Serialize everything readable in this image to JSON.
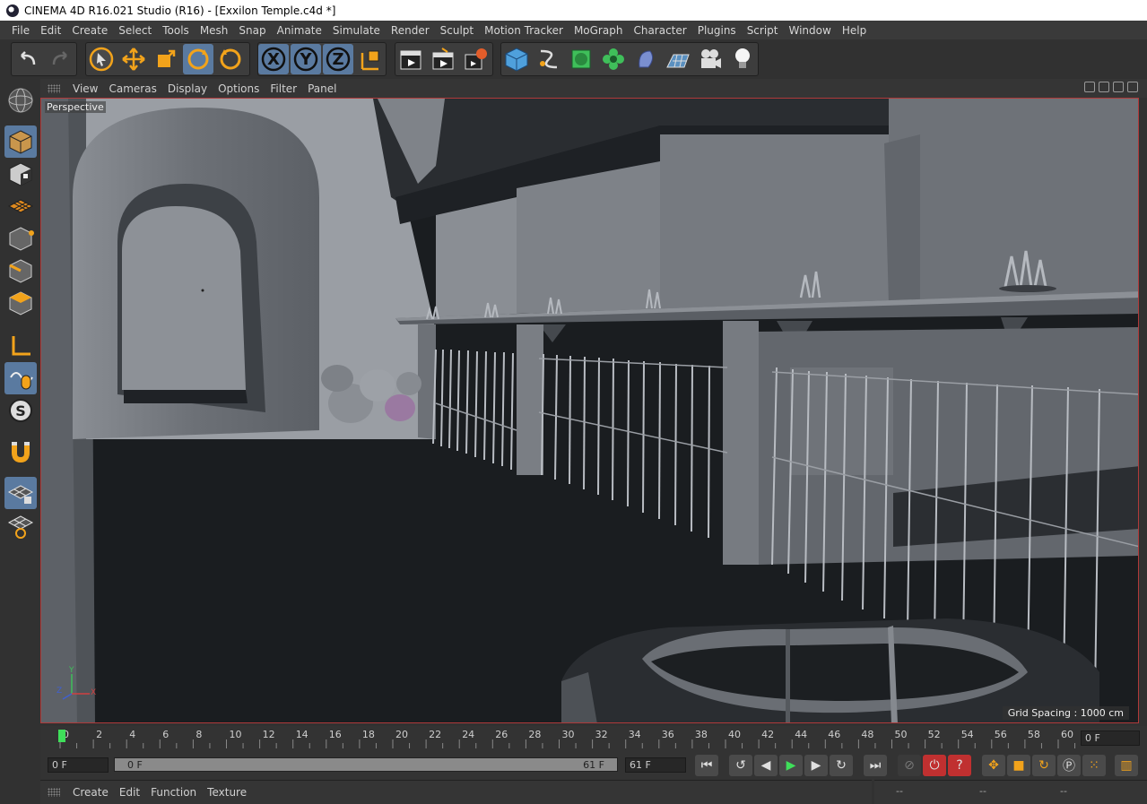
{
  "window": {
    "title": "CINEMA 4D R16.021 Studio (R16) - [Exxilon Temple.c4d *]"
  },
  "menu": [
    "File",
    "Edit",
    "Create",
    "Select",
    "Tools",
    "Mesh",
    "Snap",
    "Animate",
    "Simulate",
    "Render",
    "Sculpt",
    "Motion Tracker",
    "MoGraph",
    "Character",
    "Plugins",
    "Script",
    "Window",
    "Help"
  ],
  "toolbar": {
    "axis_x": "X",
    "axis_y": "Y",
    "axis_z": "Z"
  },
  "viewport": {
    "menu": [
      "View",
      "Cameras",
      "Display",
      "Options",
      "Filter",
      "Panel"
    ],
    "label": "Perspective",
    "grid_spacing": "Grid Spacing : 1000 cm",
    "axis_y": "Y",
    "axis_x": "X",
    "axis_z": "Z"
  },
  "timeline": {
    "ticks": [
      "0",
      "2",
      "4",
      "6",
      "8",
      "10",
      "12",
      "14",
      "16",
      "18",
      "20",
      "22",
      "24",
      "26",
      "28",
      "30",
      "32",
      "34",
      "36",
      "38",
      "40",
      "42",
      "44",
      "46",
      "48",
      "50",
      "52",
      "54",
      "56",
      "58",
      "60"
    ],
    "current_frame": "0 F",
    "start_frame": "0 F",
    "range_start": "0 F",
    "range_end": "61 F",
    "end_frame": "61 F"
  },
  "controls": {
    "play_symbol": "▶",
    "help_symbol": "?"
  },
  "bottom_panel": {
    "menu": [
      "Create",
      "Edit",
      "Function",
      "Texture"
    ],
    "right_fields": [
      "--",
      "--",
      "--"
    ]
  },
  "colors": {
    "accent_blue": "#5a7aa0",
    "viewport_border": "#b03a3a",
    "tool_orange": "#f2a31b"
  }
}
